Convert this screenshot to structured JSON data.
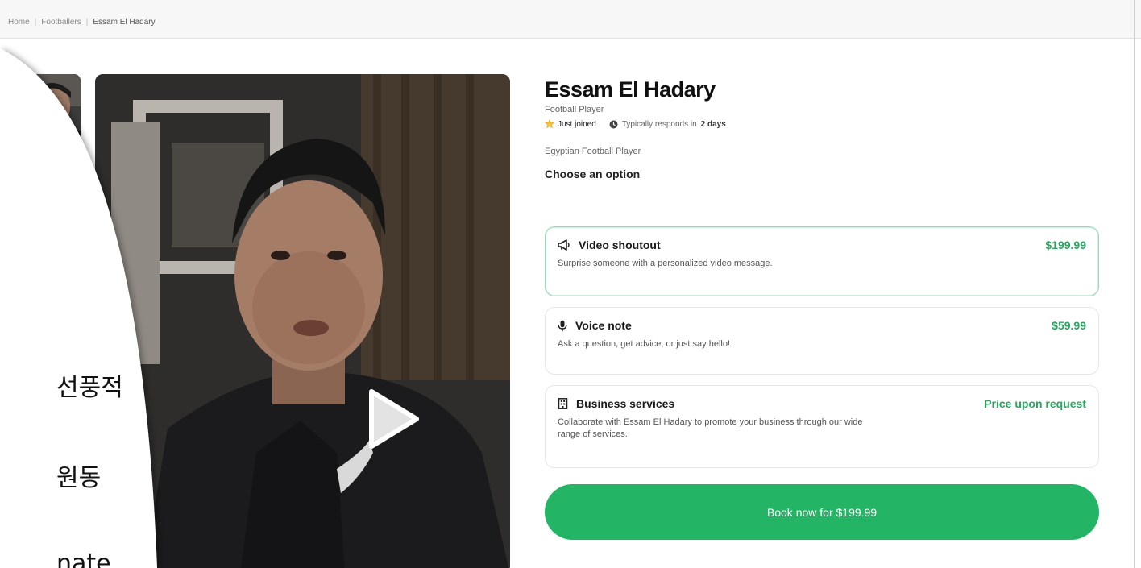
{
  "breadcrumb": {
    "home": "Home",
    "category": "Footballers",
    "current": "Essam El Hadary"
  },
  "profile": {
    "name": "Essam El Hadary",
    "role": "Football Player",
    "joined": "Just joined",
    "responds_prefix": "Typically responds in",
    "responds_value": "2 days",
    "bio": "Egyptian Football Player"
  },
  "options_heading": "Choose an option",
  "options": [
    {
      "title": "Video shoutout",
      "price": "$199.99",
      "description": "Surprise someone with a personalized video message.",
      "icon": "megaphone-icon"
    },
    {
      "title": "Voice note",
      "price": "$59.99",
      "description": "Ask a question, get advice, or just say hello!",
      "icon": "microphone-icon"
    },
    {
      "title": "Business services",
      "price": "Price upon request",
      "description": "Collaborate with Essam El Hadary to promote your business through our wide range of services.",
      "icon": "building-icon"
    }
  ],
  "book_button": "Book now for $199.99",
  "overlay": {
    "line1": "선풍적",
    "line2": "원동",
    "line3": "nate"
  },
  "colors": {
    "accent": "#23b465",
    "price": "#2aa561",
    "selected_border": "#9fd8bb"
  }
}
